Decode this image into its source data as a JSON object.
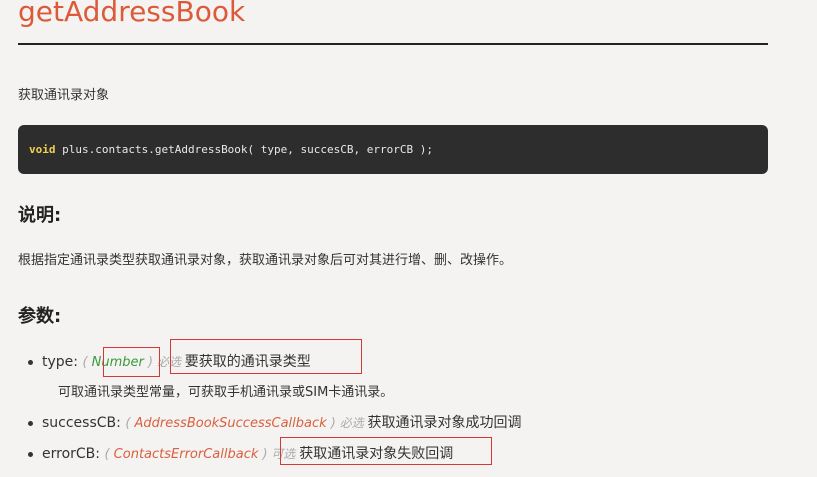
{
  "page": {
    "title": "getAddressBook",
    "description": "获取通讯录对象"
  },
  "code": {
    "keyword": "void",
    "signature": " plus.contacts.getAddressBook( type, succesCB, errorCB );"
  },
  "explain": {
    "heading": "说明:",
    "text": "根据指定通讯录类型获取通讯录对象，获取通讯录对象后可对其进行增、删、改操作。"
  },
  "params": {
    "heading": "参数:",
    "items": [
      {
        "name": "type: ",
        "open": "( ",
        "type": "Number",
        "close": " )",
        "required": " 必选 ",
        "desc": "要获取的通讯录类型",
        "sub_desc": "可取通讯录类型常量，可获取手机通讯录或SIM卡通讯录。"
      },
      {
        "name": "successCB: ",
        "open": "( ",
        "type": "AddressBookSuccessCallback",
        "close": " )",
        "required": " 必选 ",
        "desc": "获取通讯录对象成功回调"
      },
      {
        "name": "errorCB: ",
        "open": "( ",
        "type": "ContactsErrorCallback",
        "close": " )",
        "required": " 可选 ",
        "desc": "获取通讯录对象失败回调"
      }
    ]
  },
  "colors": {
    "title": "#dc5a3a",
    "code_bg": "#2d2d2d",
    "code_keyword": "#f0d050",
    "type_link": "#d9603f",
    "type_number": "#3a9a3a",
    "highlight_border": "#d23a3a"
  }
}
